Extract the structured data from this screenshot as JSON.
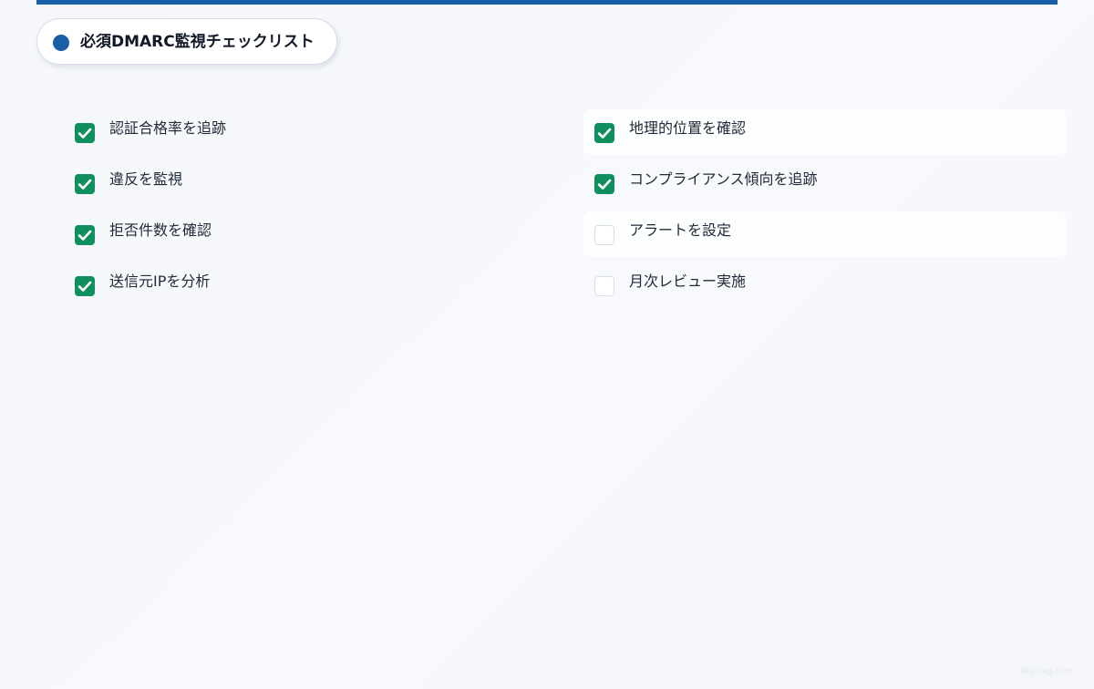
{
  "header": {
    "title": "必須DMARC監視チェックリスト"
  },
  "checklist": {
    "items": [
      {
        "label": "認証合格率を追跡",
        "checked": true
      },
      {
        "label": "地理的位置を確認",
        "checked": true
      },
      {
        "label": "違反を監視",
        "checked": true
      },
      {
        "label": "コンプライアンス傾向を追跡",
        "checked": true
      },
      {
        "label": "拒否件数を確認",
        "checked": true
      },
      {
        "label": "アラートを設定",
        "checked": false
      },
      {
        "label": "送信元IPを分析",
        "checked": true
      },
      {
        "label": "月次レビュー実施",
        "checked": false
      }
    ]
  },
  "footer": {
    "watermark": "skymag.com"
  },
  "colors": {
    "accent": "#1a5ea8",
    "check_green": "#0e8f5d"
  },
  "icons": {
    "title_marker": "blue-dot-icon",
    "checked": "checkmark-icon",
    "unchecked": "empty-checkbox-icon"
  }
}
